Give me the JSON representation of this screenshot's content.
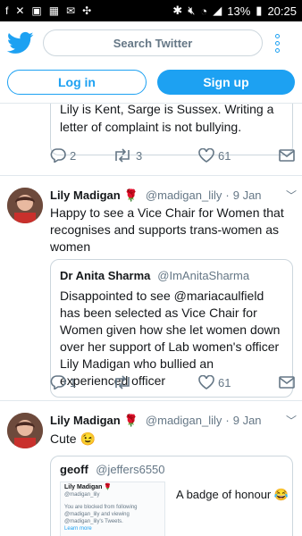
{
  "statusbar": {
    "left_icons": [
      "f",
      "✕",
      "▣",
      "▦",
      "✉",
      "✣"
    ],
    "battery": "13%",
    "time": "20:25"
  },
  "header": {
    "search_placeholder": "Search Twitter"
  },
  "auth": {
    "login_label": "Log in",
    "signup_label": "Sign up"
  },
  "tweets": [
    {
      "quote_text_partial": "Lily is Kent, Sarge is Sussex. Writing a letter of complaint is not bullying.",
      "replies": "2",
      "retweets": "3",
      "likes": "61"
    },
    {
      "name": "Lily Madigan",
      "emoji": "🌹",
      "handle": "@madigan_lily",
      "date": "9 Jan",
      "text": "Happy to see a Vice Chair for Women that recognises and supports trans-women as women",
      "quote": {
        "name": "Dr Anita Sharma",
        "handle": "@ImAnitaSharma",
        "text": "Disappointed to see @mariacaulfield has been selected as Vice Chair for Women given how she let women down over her support of Lab women's officer Lily Madigan who bullied an experienced officer"
      },
      "replies": "1",
      "retweets": "",
      "likes": "61"
    },
    {
      "name": "Lily Madigan",
      "emoji": "🌹",
      "handle": "@madigan_lily",
      "date": "9 Jan",
      "text": "Cute 😉",
      "quote": {
        "name": "geoff",
        "handle": "@jeffers6550",
        "text": "A badge of honour 😂",
        "card": {
          "name": "Lily Madigan 🌹",
          "handle": "@madigan_lily",
          "text": "You are blocked from following @madigan_lily and viewing @madigan_lily's Tweets.",
          "link": "Learn more"
        }
      }
    }
  ],
  "colors": {
    "accent": "#1da1f2",
    "muted": "#657786",
    "border": "#e1e8ed"
  }
}
